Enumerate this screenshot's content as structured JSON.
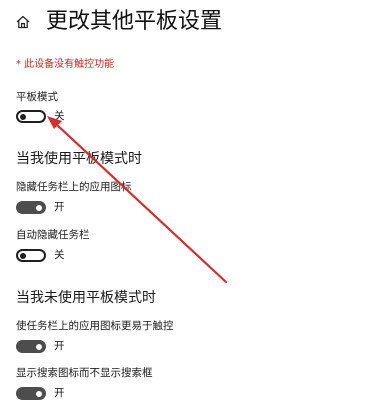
{
  "header": {
    "title": "更改其他平板设置",
    "home_icon": "home-icon"
  },
  "warning": "* 此设备没有触控功能",
  "tablet_mode": {
    "label": "平板模式",
    "toggle_on": false,
    "state_label": "关"
  },
  "section_tablet_on": {
    "heading": "当我使用平板模式时",
    "settings": [
      {
        "label": "隐藏任务栏上的应用图标",
        "toggle_on": true,
        "state_label": "开"
      },
      {
        "label": "自动隐藏任务栏",
        "toggle_on": false,
        "state_label": "关"
      }
    ]
  },
  "section_tablet_off": {
    "heading": "当我未使用平板模式时",
    "settings": [
      {
        "label": "使任务栏上的应用图标更易于触控",
        "toggle_on": true,
        "state_label": "开"
      },
      {
        "label": "显示搜索图标而不显示搜索框",
        "toggle_on": true,
        "state_label": "开"
      }
    ]
  },
  "colors": {
    "warning": "#c42b1c",
    "annotation_arrow": "#d32f2f",
    "toggle_on": "#4d4d4d",
    "toggle_off_border": "#1f1f1f"
  }
}
